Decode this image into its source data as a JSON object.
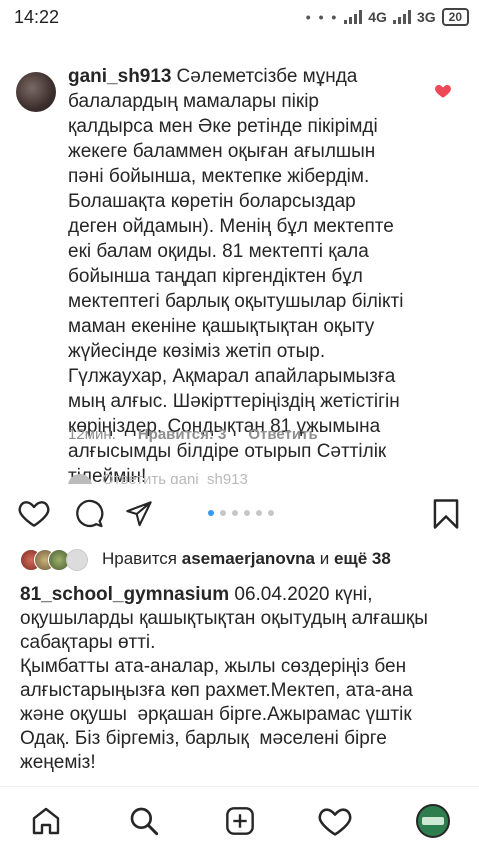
{
  "status_bar": {
    "time": "14:22",
    "dots": "• • •",
    "net1": "4G",
    "net2": "3G",
    "battery": "20"
  },
  "comment": {
    "username": "gani_sh913",
    "text": "Сәлеметсізбе мұнда балалардың мамалары пікір қалдырса мен Әке ретінде пікірімді жекеге баламмен оқыған ағылшын  пәні бойынша,  мектепке жібердім. Болашақта көретін боларсыздар деген ойдамын). Менің бұл мектепте екі балам оқиды. 81 мектепті қала бойынша таңдап кіргендіктен бұл мектептегі барлық оқытушылар білікті маман екеніне қашықтықтан оқыту жүйесінде көзіміз жетіп отыр. Гүлжаухар, Ақмарал апайларымызға мың алғыс. Шәкірттеріңіздің жетістігін көріңіздер. Сондықтан 81 ұжымына алғысымды білдіре отырып Сәттілік тілеймін!",
    "time": "12мин.",
    "likes": "Нравится: 3",
    "reply": "Ответить",
    "view_replies": "Ответить gani_sh913"
  },
  "post": {
    "likes_prefix": "Нравится",
    "likes_user": "asemaerjanovna",
    "likes_suffix": " и ",
    "likes_more": "ещё 38",
    "author": "81_school_gymnasium",
    "caption": " 06.04.2020 күні, оқушыларды қашықтықтан оқытудың алғашқы сабақтары өтті.\nҚымбатты ата-аналар, жылы сөздеріңіз бен алғыстарыңызға көп рахмет.Мектеп, ата-ана және оқушы  әрқашан бірге.Ажырамас үштік Одақ. Біз біргеміз, барлық  мәселені бірге жеңеміз!"
  },
  "carousel": {
    "count": 6,
    "active": 0
  },
  "colors": {
    "heart": "#ed4956",
    "accent": "#3897f0"
  }
}
